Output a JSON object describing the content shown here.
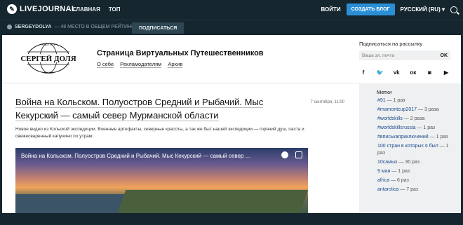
{
  "topbar": {
    "logo": "LIVEJOURNAL",
    "nav": [
      "ГЛАВНАЯ",
      "ТОП"
    ],
    "login": "ВОЙТИ",
    "create_blog": "СОЗДАТЬ БЛОГ",
    "language": "РУССКИЙ (RU)",
    "icons": {
      "logo": "livejournal-logo-icon",
      "search": "search-icon"
    }
  },
  "userbar": {
    "username": "SERGEYDOLYA",
    "rank": "— 48 МЕСТО В ОБЩЕМ РЕЙТИНГЕ",
    "subscribe": "ПОДПИСАТЬСЯ"
  },
  "header": {
    "site_title": "Страница Виртуальных Путешественников",
    "nav": [
      "О себе",
      "Рекламодателям",
      "Архив"
    ],
    "logo_text": "СЕРГЕЙ ДОЛЯ",
    "logo_top": "SINCE 1976",
    "logo_bottom": "RUSSIA"
  },
  "newsletter": {
    "label": "Подписаться на рассылку",
    "placeholder": "Ваша эл. почта",
    "ok": "OK",
    "socials": [
      "facebook-icon",
      "twitter-icon",
      "vk-icon",
      "odnoklassniki-icon",
      "instagram-icon",
      "youtube-icon"
    ]
  },
  "post": {
    "title": "Война на Кольском. Полуостров Средний и Рыбачий. Мыс Кекурский — самый север Мурманской области",
    "date": "7 сентября, 11:00",
    "intro": "Новое видео из Кольской экспедиции. Военные артефакты, северные красоты, а так же быт нашей экспедиции — горячий душ, паста и свежесваренный капучино по утрам:",
    "video_title": "Война на Кольском. Полуостров Средний и Рыбачий. Мыс Кекурский — самый север ..."
  },
  "sidebar": {
    "title": "Метки",
    "tags": [
      {
        "name": "#91",
        "count": "— 1 раз"
      },
      {
        "name": "#mamontcup2017",
        "count": "— 3 раза"
      },
      {
        "name": "#worldskills",
        "count": "— 2 раза"
      },
      {
        "name": "#worldskillsrussia",
        "count": "— 1 раз"
      },
      {
        "name": "#вписькаприключений",
        "count": "— 1 раз"
      },
      {
        "name": "100 стран в которых я был",
        "count": "— 1 раз"
      },
      {
        "name": "10самых",
        "count": "— 30 раз"
      },
      {
        "name": "9 мая",
        "count": "— 1 раз"
      },
      {
        "name": "africa",
        "count": "— 6 раз"
      },
      {
        "name": "antarctica",
        "count": "— 7 раз"
      }
    ]
  }
}
